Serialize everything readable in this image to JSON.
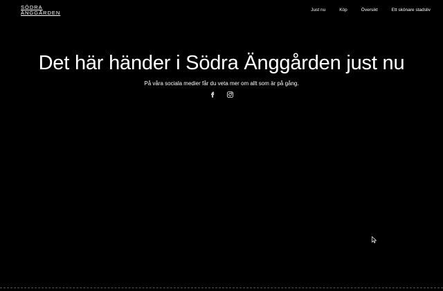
{
  "header": {
    "logo_line1": "SÖDRA",
    "logo_line2": "ÄNGGÅRDEN",
    "nav": [
      {
        "label": "Just nu"
      },
      {
        "label": "Köp"
      },
      {
        "label": "Översikt"
      },
      {
        "label": "Ett skönare stadsliv"
      }
    ]
  },
  "hero": {
    "title": "Det här händer i Södra Änggården just nu",
    "subtitle": "På våra sociala medier får du veta mer om allt som är på gång.",
    "social": [
      {
        "icon": "facebook-icon"
      },
      {
        "icon": "instagram-icon"
      }
    ]
  },
  "colors": {
    "background": "#000000",
    "text": "#ffffff"
  }
}
